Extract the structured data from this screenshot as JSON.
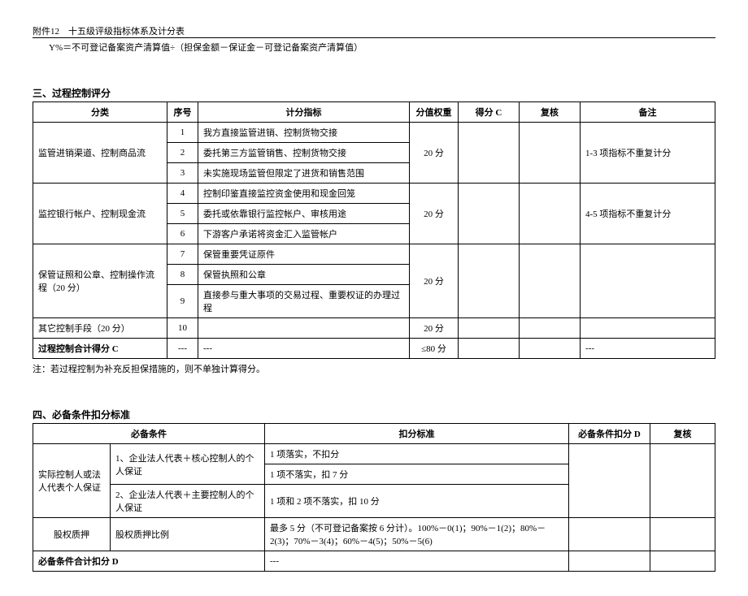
{
  "header": {
    "attachment": "附件12　十五级评级指标体系及计分表",
    "formula": "Y%＝不可登记备案资产清算值÷（担保金额－保证金－可登记备案资产清算值）"
  },
  "section3": {
    "title": "三、过程控制评分",
    "headers": {
      "category": "分类",
      "seq": "序号",
      "indicator": "计分指标",
      "weight": "分值权重",
      "scoreC": "得分 C",
      "review": "复核",
      "remark": "备注"
    },
    "groups": [
      {
        "category": "监管进销渠道、控制商品流",
        "weight": "20 分",
        "remark": "1-3 项指标不重复计分",
        "rows": [
          {
            "seq": "1",
            "indicator": "我方直接监管进销、控制货物交接"
          },
          {
            "seq": "2",
            "indicator": "委托第三方监管销售、控制货物交接"
          },
          {
            "seq": "3",
            "indicator": "未实施现场监管但限定了进货和销售范围"
          }
        ]
      },
      {
        "category": "监控银行帐户、控制现金流",
        "weight": "20 分",
        "remark": "4-5 项指标不重复计分",
        "rows": [
          {
            "seq": "4",
            "indicator": "控制印鉴直接监控资金使用和现金回笼"
          },
          {
            "seq": "5",
            "indicator": "委托或依靠银行监控帐户、审核用途"
          },
          {
            "seq": "6",
            "indicator": "下游客户承诺将资金汇入监管帐户"
          }
        ]
      },
      {
        "category": "保管证照和公章、控制操作流程（20 分）",
        "weight": "20 分",
        "remark": "",
        "rows": [
          {
            "seq": "7",
            "indicator": "保管重要凭证原件"
          },
          {
            "seq": "8",
            "indicator": "保管执照和公章"
          },
          {
            "seq": "9",
            "indicator": "直接参与重大事项的交易过程、重要权证的办理过程"
          }
        ]
      }
    ],
    "otherRow": {
      "category": "其它控制手段（20 分）",
      "seq": "10",
      "indicator": "",
      "weight": "20 分"
    },
    "totalRow": {
      "category": "过程控制合计得分 C",
      "seq": "---",
      "indicator": "---",
      "weight": "≤80 分",
      "remark": "---"
    },
    "note": "注：若过程控制为补充反担保措施的，则不单独计算得分。"
  },
  "section4": {
    "title": "四、必备条件扣分标准",
    "headers": {
      "condition": "必备条件",
      "standard": "扣分标准",
      "deductD": "必备条件扣分 D",
      "review": "复核"
    },
    "rows": [
      {
        "cat": "实际控制人或法人代表个人保证",
        "cond": "1、企业法人代表＋核心控制人的个人保证",
        "std": "1 项落实，不扣分"
      },
      {
        "std": "1 项不落实，扣 7 分"
      },
      {
        "cond": "2、企业法人代表＋主要控制人的个人保证",
        "std": "1 项和 2 项不落实，扣 10 分"
      },
      {
        "cat": "股权质押",
        "cond": "股权质押比例",
        "std": "最多 5 分（不可登记备案按 6 分计）。100%－0(1)；90%－1(2)；80%－2(3)；70%－3(4)；60%－4(5)；50%－5(6)"
      }
    ],
    "totalRow": {
      "label": "必备条件合计扣分 D",
      "dash": "---"
    }
  }
}
